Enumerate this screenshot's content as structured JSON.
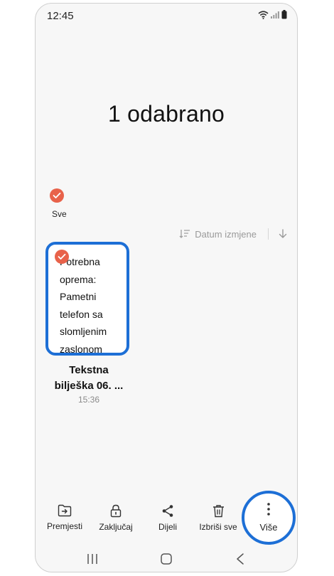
{
  "status_bar": {
    "time": "12:45"
  },
  "header": {
    "title": "1 odabrano"
  },
  "select_all": {
    "label": "Sve",
    "checked": true
  },
  "sort": {
    "label": "Datum izmjene"
  },
  "note": {
    "preview_lines": [
      "Potrebna",
      "oprema:",
      "Pametni",
      "telefon sa",
      "slomljenim",
      "zaslonom"
    ],
    "title_line1": "Tekstna",
    "title_line2": "bilješka 06. ...",
    "time": "15:36",
    "selected": true
  },
  "toolbar": {
    "move_label": "Premjesti",
    "lock_label": "Zaključaj",
    "share_label": "Dijeli",
    "delete_all_label": "Izbriši sve",
    "more_label": "Više"
  },
  "colors": {
    "accent_highlight": "#1d6fd6",
    "check": "#e8624a",
    "background": "#f7f7f7"
  }
}
